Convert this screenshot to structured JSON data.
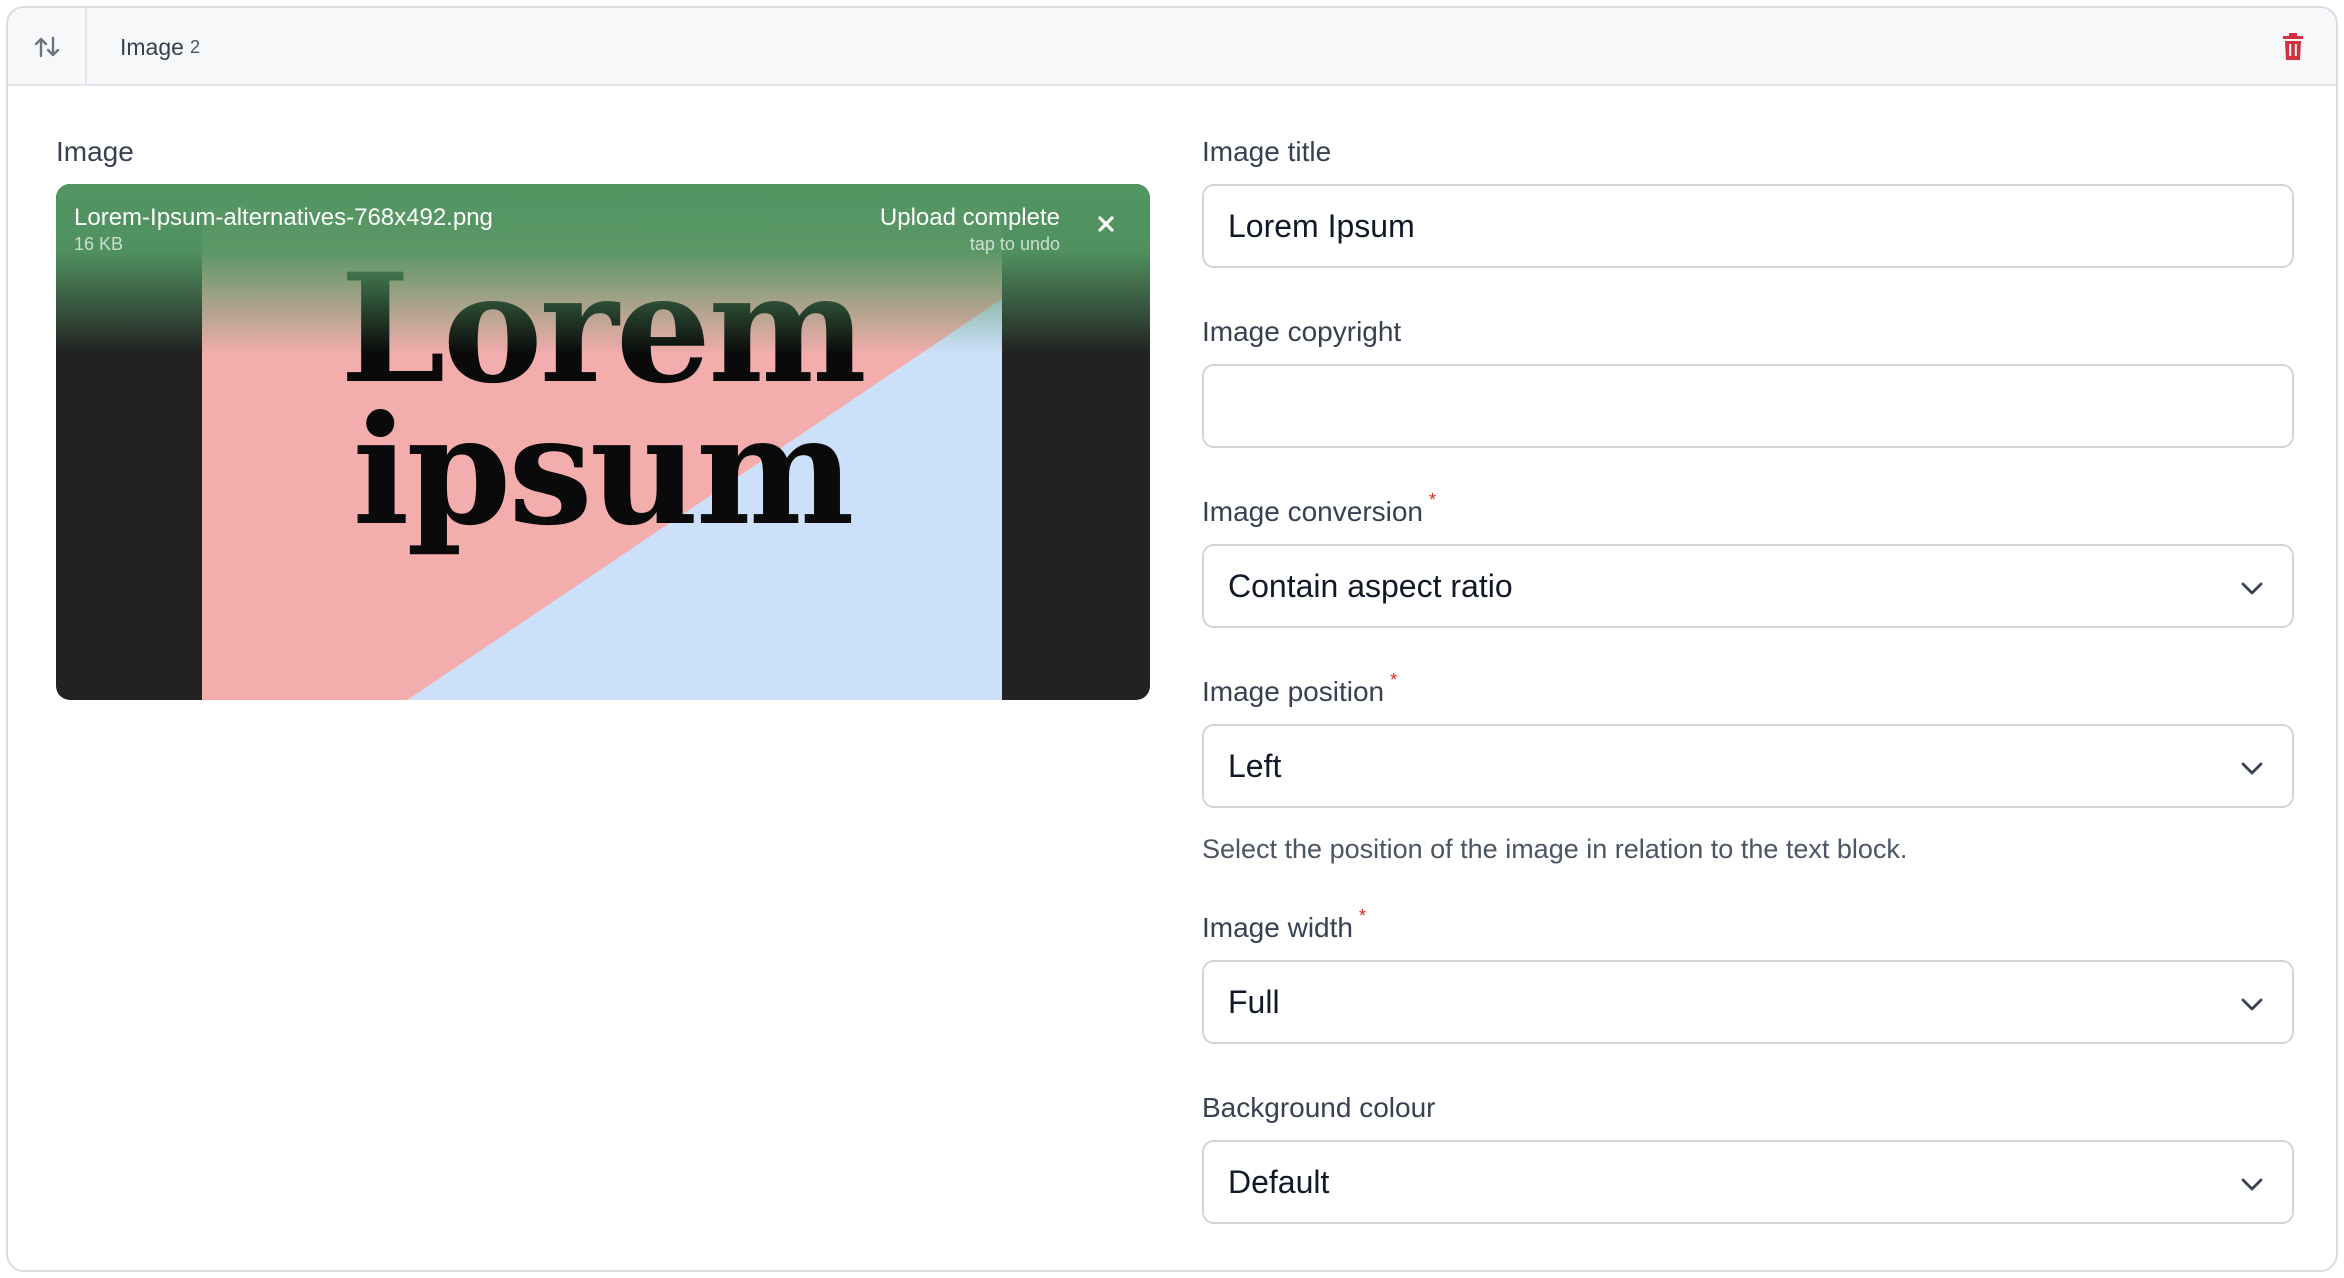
{
  "header": {
    "title": "Image",
    "index": "2",
    "reorder_icon": "sort-arrows-icon",
    "delete_icon": "trash-icon",
    "delete_color": "#d32f3f"
  },
  "image_field": {
    "label": "Image",
    "file_name": "Lorem-Ipsum-alternatives-768x492.png",
    "file_size": "16 KB",
    "status": "Upload complete",
    "undo_hint": "tap to undo",
    "preview_line1": "Lorem",
    "preview_line2": "ipsum",
    "status_color": "#529662"
  },
  "image_title": {
    "label": "Image title",
    "value": "Lorem Ipsum"
  },
  "image_copyright": {
    "label": "Image copyright",
    "value": ""
  },
  "image_conversion": {
    "label": "Image conversion",
    "required_mark": "*",
    "value": "Contain aspect ratio"
  },
  "image_position": {
    "label": "Image position",
    "required_mark": "*",
    "value": "Left",
    "help": "Select the position of the image in relation to the text block."
  },
  "image_width": {
    "label": "Image width",
    "required_mark": "*",
    "value": "Full"
  },
  "background_colour": {
    "label": "Background colour",
    "value": "Default"
  }
}
